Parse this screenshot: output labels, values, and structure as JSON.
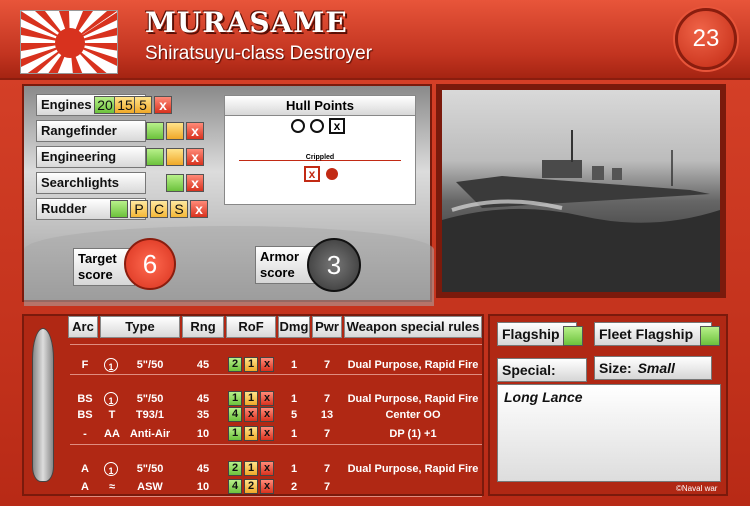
{
  "ship": {
    "name": "MURASAME",
    "class": "Shiratsuyu-class Destroyer",
    "points": "23"
  },
  "systems": [
    {
      "label": "Engines",
      "boxes": [
        {
          "t": "20",
          "c": "g"
        },
        {
          "t": "15",
          "c": "y"
        },
        {
          "t": "5",
          "c": "y"
        },
        {
          "t": "x",
          "c": "r"
        }
      ]
    },
    {
      "label": "Rangefinder",
      "boxes": [
        {
          "t": "",
          "c": "g"
        },
        {
          "t": "",
          "c": "y"
        },
        {
          "t": "x",
          "c": "r"
        }
      ]
    },
    {
      "label": "Engineering",
      "boxes": [
        {
          "t": "",
          "c": "g"
        },
        {
          "t": "",
          "c": "y"
        },
        {
          "t": "x",
          "c": "r"
        }
      ]
    },
    {
      "label": "Searchlights",
      "boxes": [
        {
          "t": "",
          "c": "g"
        },
        {
          "t": "x",
          "c": "r"
        }
      ]
    },
    {
      "label": "Rudder",
      "boxes": [
        {
          "t": "",
          "c": "g"
        },
        {
          "t": "P",
          "c": "p"
        },
        {
          "t": "C",
          "c": "p"
        },
        {
          "t": "S",
          "c": "p"
        },
        {
          "t": "x",
          "c": "r"
        }
      ]
    }
  ],
  "hull": {
    "title": "Hull Points",
    "crippled_label": "Crippled"
  },
  "scores": {
    "target_label": "Target score",
    "target_value": "6",
    "armor_label": "Armor score",
    "armor_value": "3"
  },
  "table": {
    "headers": [
      "Arc",
      "Type",
      "Rng",
      "RoF",
      "Dmg",
      "Pwr",
      "Weapon special rules"
    ],
    "rows": [
      {
        "arc": "F",
        "type_mark": "1",
        "type": "5\"/50",
        "rng": "45",
        "rof": [
          "2",
          "1",
          "x"
        ],
        "dmg": "1",
        "pwr": "7",
        "rules": "Dual Purpose, Rapid Fire"
      },
      {
        "arc": "BS",
        "type_mark": "1",
        "type": "5\"/50",
        "rng": "45",
        "rof": [
          "1",
          "1",
          "x"
        ],
        "dmg": "1",
        "pwr": "7",
        "rules": "Dual Purpose, Rapid Fire"
      },
      {
        "arc": "BS",
        "type_mark": "T",
        "type": "T93/1",
        "rng": "35",
        "rof": [
          "4",
          "x",
          "x"
        ],
        "dmg": "5",
        "pwr": "13",
        "rules": "Center OO"
      },
      {
        "arc": "-",
        "type_mark": "AA",
        "type": "Anti-Air",
        "rng": "10",
        "rof": [
          "1",
          "1",
          "x"
        ],
        "dmg": "1",
        "pwr": "7",
        "rules": "DP (1) +1"
      },
      {
        "arc": "A",
        "type_mark": "1",
        "type": "5\"/50",
        "rng": "45",
        "rof": [
          "2",
          "1",
          "x"
        ],
        "dmg": "1",
        "pwr": "7",
        "rules": "Dual Purpose, Rapid Fire"
      },
      {
        "arc": "A",
        "type_mark": "≈",
        "type": "ASW",
        "rng": "10",
        "rof": [
          "4",
          "2",
          "x"
        ],
        "dmg": "2",
        "pwr": "7",
        "rules": ""
      }
    ]
  },
  "side": {
    "flagship": "Flagship",
    "fleet_flagship": "Fleet Flagship",
    "special": "Special:",
    "size_label": "Size:",
    "size_value": "Small",
    "notes": "Long Lance",
    "credit": "©Naval war"
  }
}
